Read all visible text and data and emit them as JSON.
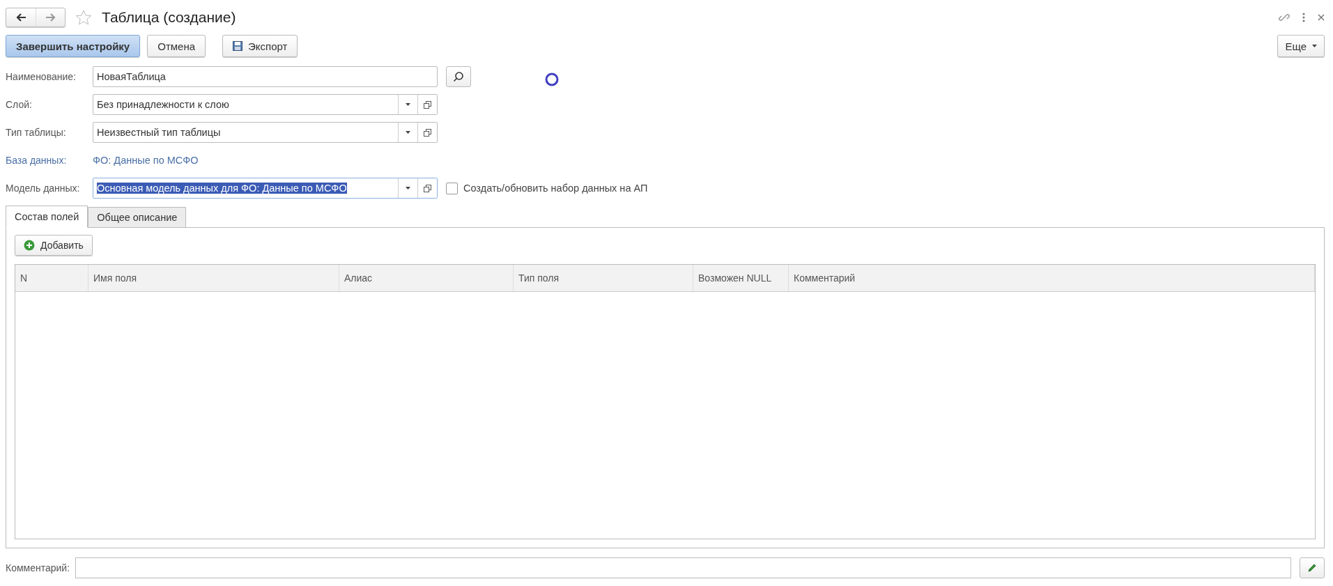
{
  "window": {
    "title": "Таблица (создание)",
    "favorite": false
  },
  "toolbar": {
    "buttons": [
      {
        "label": "Завершить настройку",
        "kind": "primary"
      },
      {
        "label": "Отмена",
        "kind": "plain"
      },
      {
        "label": "Экспорт",
        "kind": "save"
      }
    ],
    "more": "Еще"
  },
  "fields": [
    {
      "label": "Наименование:",
      "kind": "text",
      "value": "НоваяТаблица"
    },
    {
      "label": "Слой:",
      "kind": "select",
      "value": "Без принадлежности к слою"
    },
    {
      "label": "Тип таблицы:",
      "kind": "select",
      "value": "Неизвестный тип таблицы"
    },
    {
      "label": "База данных:",
      "kind": "link",
      "value": "ФО: Данные по МСФО"
    },
    {
      "label": "Модель данных:",
      "kind": "select",
      "value": "Основная модель данных для ФО: Данные по МСФО",
      "text_selected": true
    }
  ],
  "sync_checkbox": {
    "label": "Создать/обновить набор данных на АП",
    "checked": false
  },
  "tabs": [
    {
      "label": "Состав полей",
      "selected": true
    },
    {
      "label": "Общее описание",
      "selected": false
    }
  ],
  "add_button": "Добавить",
  "table": {
    "columns": [
      "N",
      "Имя поля",
      "Алиас",
      "Тип поля",
      "Возможен NULL",
      "Комментарий"
    ]
  },
  "comment": {
    "label": "Комментарий:"
  }
}
